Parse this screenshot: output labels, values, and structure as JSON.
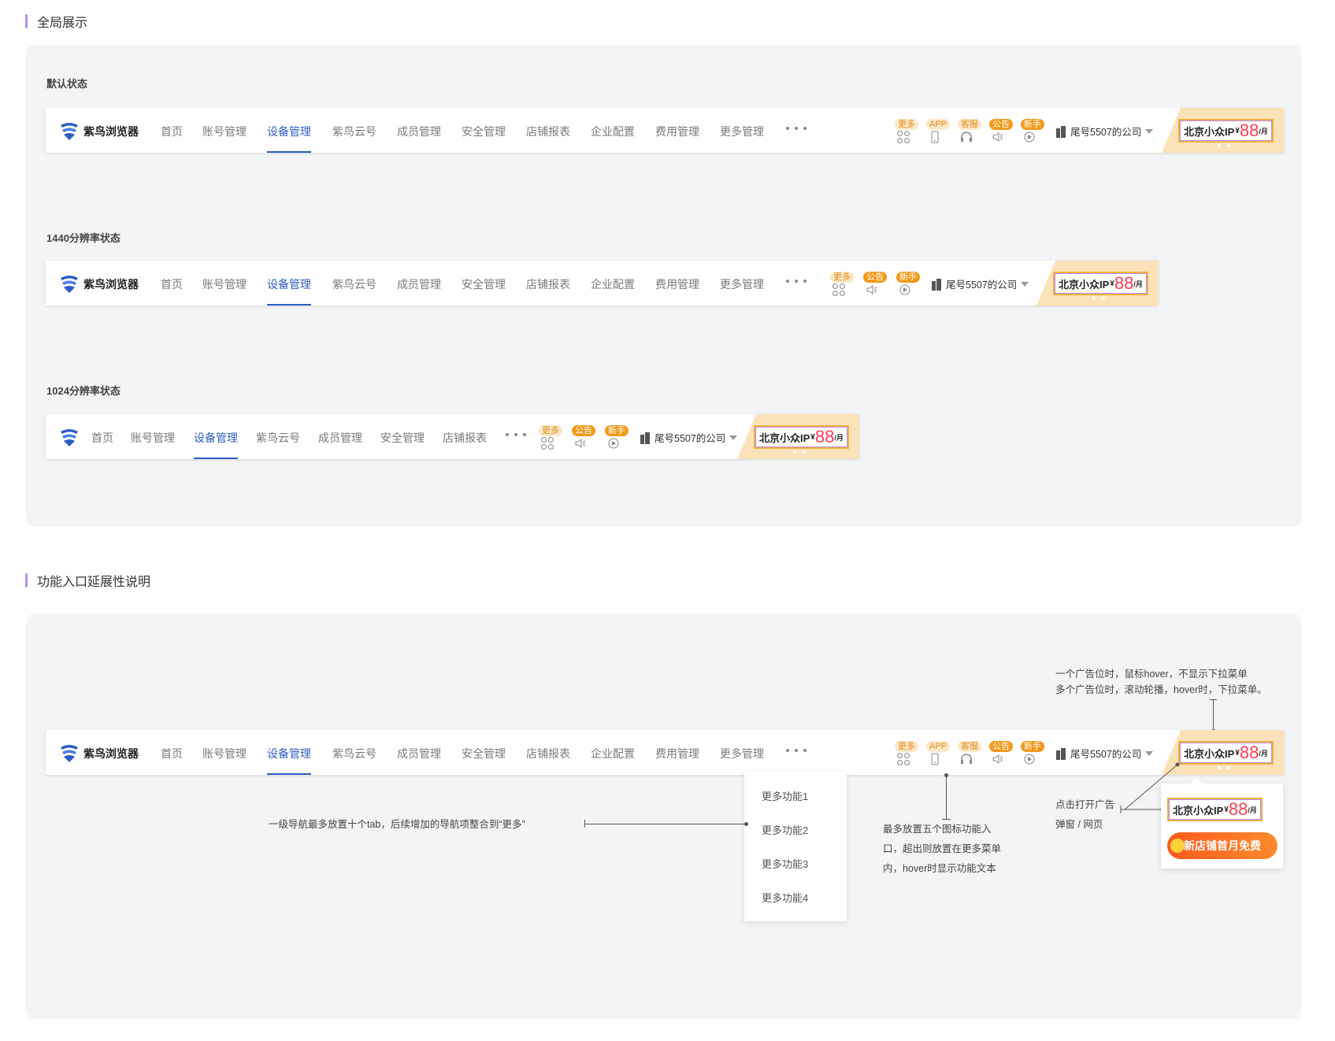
{
  "sections": {
    "overview_title": "全局展示",
    "extension_title": "功能入口延展性说明"
  },
  "states": {
    "default": "默认状态",
    "r1440": "1440分辨率状态",
    "r1024": "1024分辨率状态"
  },
  "nav": {
    "brand": "紫鸟浏览器",
    "tabs": [
      "首页",
      "账号管理",
      "设备管理",
      "紫鸟云号",
      "成员管理",
      "安全管理",
      "店铺报表",
      "企业配置",
      "费用管理",
      "更多管理"
    ],
    "active_tab": "设备管理"
  },
  "func_icons": {
    "more": "更多",
    "app": "APP",
    "service": "客服",
    "notice": "公告",
    "newbie": "新手"
  },
  "company": {
    "name": "尾号5507的公司"
  },
  "ad": {
    "text": "北京小众IP",
    "currency": "¥",
    "price": "88",
    "unit": "/月"
  },
  "dropdown": {
    "items": [
      "更多功能1",
      "更多功能2",
      "更多功能3",
      "更多功能4"
    ]
  },
  "annotations": {
    "tabs_note": "一级导航最多放置十个tab，后续增加的导航项整合到“更多”",
    "icons_note_lines": [
      "最多放置五个图标功能入",
      "口，超出则放置在更多菜单",
      "内，hover时显示功能文本"
    ],
    "ad_note_lines": [
      "一个广告位时，鼠标hover，不显示下拉菜单",
      "多个广告位时，滚动轮播，hover时，下拉菜单。"
    ],
    "click_note_lines": [
      "点击打开广告",
      "弹窗 / 网页"
    ]
  },
  "popup": {
    "promo_text": "新店铺首月免费"
  },
  "colors": {
    "accent": "#2f5dc4",
    "section_bar": "#b58cf2",
    "badge_orange": "#f29a1c",
    "ad_bg": "#fce2b8",
    "price_red": "#ff3d55"
  }
}
